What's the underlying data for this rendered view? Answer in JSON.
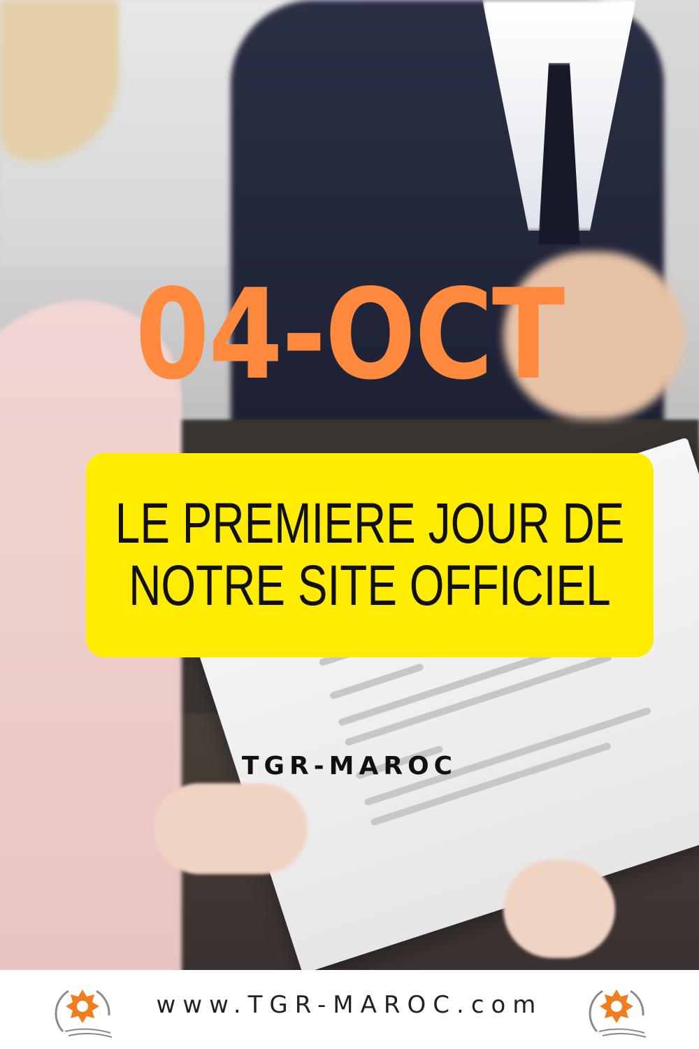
{
  "headline": {
    "date": "04-OCT",
    "banner_lines": [
      "LE PREMIERE JOUR DE",
      "NOTRE SITE OFFICIEL"
    ],
    "brand": "TGR-MAROC"
  },
  "footer": {
    "url": "www.TGR-MAROC.com",
    "logo_icon": "sun-star-icon"
  },
  "colors": {
    "date": "#ff8a3d",
    "banner": "#ffec00",
    "logo_accent": "#f07d1e"
  }
}
